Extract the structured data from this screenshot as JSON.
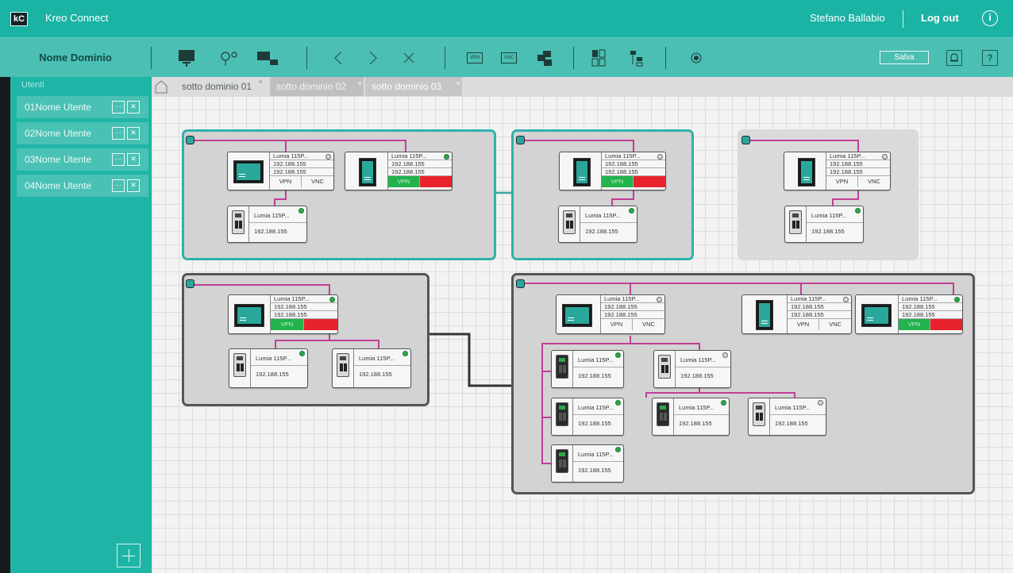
{
  "app": {
    "title": "Kreo Connect",
    "logo": "kC",
    "user": "Stefano Ballabio",
    "logout": "Log out"
  },
  "toolbar": {
    "domain": "Nome Dominio",
    "save": "Salva",
    "vpn": "VPN",
    "vnc": "VNC",
    "help": "?",
    "icons": [
      "monitor-icon",
      "network-icon",
      "device-link-icon",
      "back-icon",
      "forward-icon",
      "close-icon",
      "vpn-icon",
      "vnc-icon",
      "copy-icon",
      "grid-icon",
      "tree-icon",
      "record-icon",
      "bell-icon",
      "help-icon"
    ]
  },
  "sidebar": {
    "header": "Utenti",
    "users": [
      "01Nome Utente",
      "02Nome Utente",
      "03Nome Utente",
      "04Nome Utente"
    ]
  },
  "tabs": [
    "sotto dominio 01",
    "sotto dominio 02",
    "sotto dominio 03"
  ],
  "device": {
    "name": "Lumia 115P...",
    "ip": "192.188.155",
    "vpn": "VPN",
    "vnc": "VNC"
  },
  "colors": {
    "accent": "#1ab3a4",
    "wire": "#c03e96",
    "online": "#2fa64e",
    "vpn_on": "#22b34e",
    "vnc_alert": "#e8232c"
  }
}
